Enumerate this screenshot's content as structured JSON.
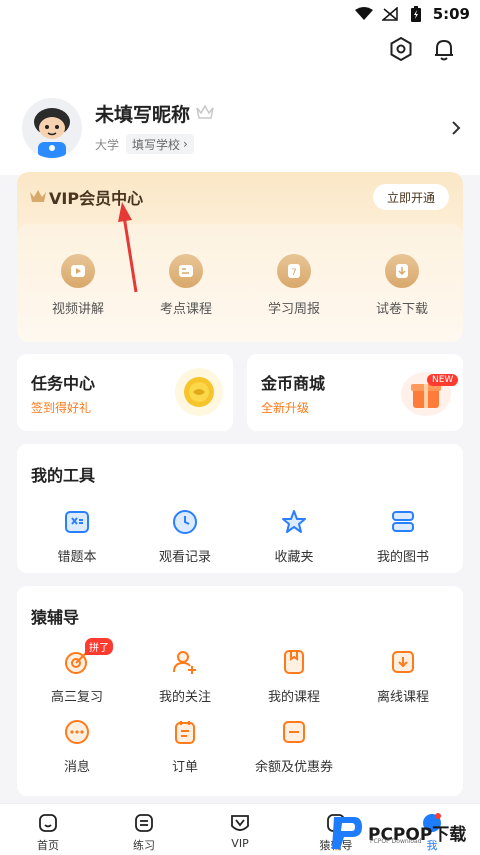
{
  "status_bar": {
    "time": "5:09"
  },
  "header": {
    "settings_icon": "hexagon-settings-icon",
    "bell_icon": "bell-icon"
  },
  "profile": {
    "nickname": "未填写昵称",
    "edu_level": "大学",
    "school_placeholder": "填写学校",
    "school_arrow": "›"
  },
  "vip": {
    "title": "VIP会员中心",
    "open_button": "立即开通",
    "items": [
      {
        "label": "视频讲解",
        "icon": "video-play-icon"
      },
      {
        "label": "考点课程",
        "icon": "course-card-icon"
      },
      {
        "label": "学习周报",
        "icon": "calendar-7-icon"
      },
      {
        "label": "试卷下载",
        "icon": "download-icon"
      }
    ]
  },
  "task_center": {
    "title": "任务中心",
    "subtitle": "签到得好礼"
  },
  "coin_mall": {
    "title": "金币商城",
    "subtitle": "全新升级",
    "badge": "NEW"
  },
  "tools": {
    "title": "我的工具",
    "items": [
      {
        "label": "错题本",
        "icon": "wrong-book-icon"
      },
      {
        "label": "观看记录",
        "icon": "clock-icon"
      },
      {
        "label": "收藏夹",
        "icon": "star-icon"
      },
      {
        "label": "我的图书",
        "icon": "books-icon"
      }
    ]
  },
  "tutoring": {
    "title": "猿辅导",
    "items": [
      {
        "label": "高三复习",
        "icon": "target-icon",
        "badge": "拼了"
      },
      {
        "label": "我的关注",
        "icon": "user-add-icon"
      },
      {
        "label": "我的课程",
        "icon": "my-course-icon"
      },
      {
        "label": "离线课程",
        "icon": "offline-download-icon"
      },
      {
        "label": "消息",
        "icon": "message-icon"
      },
      {
        "label": "订单",
        "icon": "order-icon"
      },
      {
        "label": "余额及优惠券",
        "icon": "coupon-icon"
      }
    ]
  },
  "bottom_nav": {
    "items": [
      {
        "label": "首页",
        "icon": "home-icon"
      },
      {
        "label": "练习",
        "icon": "practice-icon"
      },
      {
        "label": "VIP",
        "icon": "vip-icon"
      },
      {
        "label": "猿辅导",
        "icon": "tutoring-icon"
      },
      {
        "label": "我",
        "icon": "me-icon",
        "active": true
      }
    ]
  },
  "watermark": {
    "text": "PCPOP下载",
    "sub": "PCPOP Download"
  },
  "colors": {
    "accent_orange": "#ff7a1a",
    "active_blue": "#1e7cff",
    "vip_gold": "#d9a86b"
  }
}
